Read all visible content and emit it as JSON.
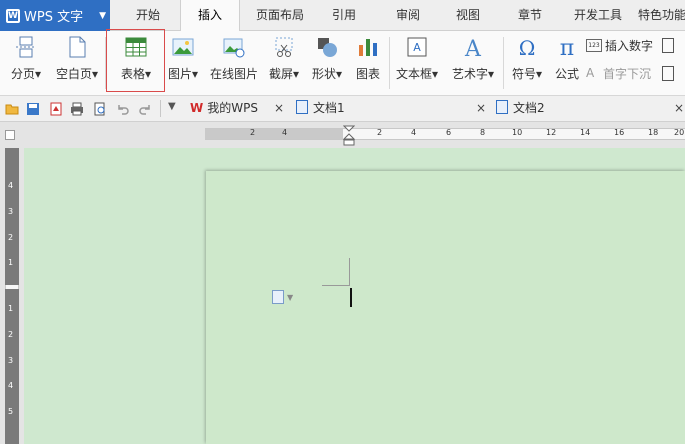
{
  "app": {
    "title": "WPS 文字",
    "logo_letter": "W"
  },
  "menu_tabs": [
    {
      "label": "开始",
      "x": 0
    },
    {
      "label": "插入",
      "x": 1
    },
    {
      "label": "页面布局",
      "x": 2
    },
    {
      "label": "引用",
      "x": 3
    },
    {
      "label": "审阅",
      "x": 4
    },
    {
      "label": "视图",
      "x": 5
    },
    {
      "label": "章节",
      "x": 6
    },
    {
      "label": "开发工具",
      "x": 7
    },
    {
      "label": "特色功能",
      "x": 8
    }
  ],
  "ribbon": {
    "page_break": "分页",
    "blank_page": "空白页",
    "table": "表格",
    "picture": "图片",
    "online_picture": "在线图片",
    "screenshot": "截屏",
    "shapes": "形状",
    "chart": "图表",
    "textbox": "文本框",
    "wordart": "艺术字",
    "symbol": "符号",
    "formula": "公式",
    "insert_number": "插入数字",
    "drop_cap": "首字下沉",
    "dropdown_glyph": "▾"
  },
  "doc_tabs": [
    {
      "label": "我的WPS"
    },
    {
      "label": "文档1"
    },
    {
      "label": "文档2"
    }
  ],
  "close_glyph": "×",
  "ruler_h": [
    "2",
    "4",
    "2",
    "4",
    "6",
    "8",
    "10",
    "12",
    "14",
    "16",
    "18",
    "20"
  ],
  "ruler_v": [
    "4",
    "3",
    "2",
    "1",
    "1",
    "2",
    "3",
    "4",
    "5"
  ],
  "colors": {
    "app_blue": "#2f6fc3",
    "highlight_red": "#d94b4b",
    "page_bg": "#cee8cb",
    "desk_bg": "#cfe8cf"
  }
}
